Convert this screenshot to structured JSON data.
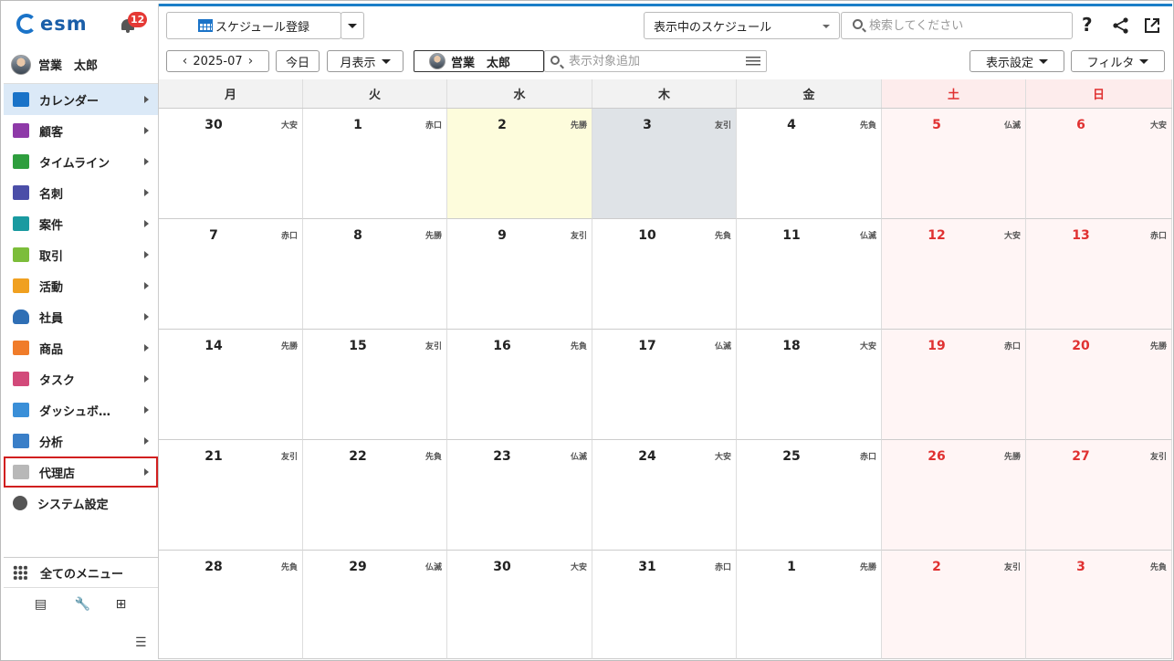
{
  "app": {
    "logo_text": "esm",
    "notification_count": "12"
  },
  "user": {
    "name": "営業　太郎"
  },
  "sidebar": {
    "items": [
      {
        "label": "カレンダー",
        "icon": "calendar-icon",
        "color": "#1a73c8"
      },
      {
        "label": "顧客",
        "icon": "building-icon",
        "color": "#8e3aa8"
      },
      {
        "label": "タイムライン",
        "icon": "chat-icon",
        "color": "#2e9e3e"
      },
      {
        "label": "名刺",
        "icon": "business-card-icon",
        "color": "#4b4ea8"
      },
      {
        "label": "案件",
        "icon": "folder-icon",
        "color": "#1a9aa0"
      },
      {
        "label": "取引",
        "icon": "ledger-icon",
        "color": "#7cbd3a"
      },
      {
        "label": "活動",
        "icon": "clipboard-icon",
        "color": "#f0a020"
      },
      {
        "label": "社員",
        "icon": "person-icon",
        "color": "#2f6fb5"
      },
      {
        "label": "商品",
        "icon": "box-icon",
        "color": "#f07c2a"
      },
      {
        "label": "タスク",
        "icon": "checkbox-icon",
        "color": "#d24a7a"
      },
      {
        "label": "ダッシュボ…",
        "icon": "dashboard-icon",
        "color": "#3a8fd8"
      },
      {
        "label": "分析",
        "icon": "bar-chart-icon",
        "color": "#3a7fc8"
      },
      {
        "label": "代理店",
        "icon": "document-icon",
        "color": "#b8b8b8"
      },
      {
        "label": "システム設定",
        "icon": "gear-icon",
        "color": "#555555"
      }
    ],
    "all_menu_label": "全てのメニュー"
  },
  "toolbar": {
    "register_label": "スケジュール登録",
    "view_select_label": "表示中のスケジュール",
    "search_placeholder": "検索してください",
    "help_label": "?",
    "month_value": "2025-07",
    "today_label": "今日",
    "month_view_label": "月表示",
    "person_chip_label": "営業　太郎",
    "target_placeholder": "表示対象追加",
    "display_settings_label": "表示設定",
    "filter_label": "フィルタ"
  },
  "calendar": {
    "weekdays": [
      "月",
      "火",
      "水",
      "木",
      "金",
      "土",
      "日"
    ],
    "weeks": [
      [
        {
          "day": "30",
          "rokuyo": "大安"
        },
        {
          "day": "1",
          "rokuyo": "赤口"
        },
        {
          "day": "2",
          "rokuyo": "先勝"
        },
        {
          "day": "3",
          "rokuyo": "友引"
        },
        {
          "day": "4",
          "rokuyo": "先負"
        },
        {
          "day": "5",
          "rokuyo": "仏滅"
        },
        {
          "day": "6",
          "rokuyo": "大安"
        }
      ],
      [
        {
          "day": "7",
          "rokuyo": "赤口"
        },
        {
          "day": "8",
          "rokuyo": "先勝"
        },
        {
          "day": "9",
          "rokuyo": "友引"
        },
        {
          "day": "10",
          "rokuyo": "先負"
        },
        {
          "day": "11",
          "rokuyo": "仏滅"
        },
        {
          "day": "12",
          "rokuyo": "大安"
        },
        {
          "day": "13",
          "rokuyo": "赤口"
        }
      ],
      [
        {
          "day": "14",
          "rokuyo": "先勝"
        },
        {
          "day": "15",
          "rokuyo": "友引"
        },
        {
          "day": "16",
          "rokuyo": "先負"
        },
        {
          "day": "17",
          "rokuyo": "仏滅"
        },
        {
          "day": "18",
          "rokuyo": "大安"
        },
        {
          "day": "19",
          "rokuyo": "赤口"
        },
        {
          "day": "20",
          "rokuyo": "先勝"
        }
      ],
      [
        {
          "day": "21",
          "rokuyo": "友引"
        },
        {
          "day": "22",
          "rokuyo": "先負"
        },
        {
          "day": "23",
          "rokuyo": "仏滅"
        },
        {
          "day": "24",
          "rokuyo": "大安"
        },
        {
          "day": "25",
          "rokuyo": "赤口"
        },
        {
          "day": "26",
          "rokuyo": "先勝"
        },
        {
          "day": "27",
          "rokuyo": "友引"
        }
      ],
      [
        {
          "day": "28",
          "rokuyo": "先負"
        },
        {
          "day": "29",
          "rokuyo": "仏滅"
        },
        {
          "day": "30",
          "rokuyo": "大安"
        },
        {
          "day": "31",
          "rokuyo": "赤口"
        },
        {
          "day": "1",
          "rokuyo": "先勝"
        },
        {
          "day": "2",
          "rokuyo": "友引"
        },
        {
          "day": "3",
          "rokuyo": "先負"
        }
      ]
    ]
  },
  "colors": {
    "accent": "#1b7fc8",
    "weekend_text": "#e03131",
    "today_bg": "#fdfcdc",
    "selected_bg": "#dfe3e7",
    "highlight_border": "#d11f1f"
  }
}
